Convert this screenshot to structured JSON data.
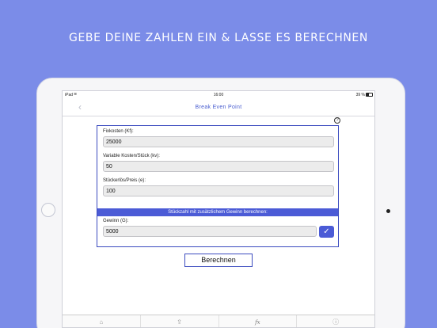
{
  "headline": "GEBE DEINE ZAHLEN EIN & LASSE ES BERECHNEN",
  "statusbar": {
    "carrier": "iPad",
    "time": "16:00",
    "battery": "39 %"
  },
  "navbar": {
    "back_icon": "‹",
    "title": "Break Even Point"
  },
  "help_icon": "?",
  "form": {
    "fixkosten": {
      "label": "Fixkosten (Kf):",
      "value": "25000"
    },
    "variable": {
      "label": "Variable Kosten/Stück (kv):",
      "value": "50"
    },
    "preis": {
      "label": "Stückerlös/Preis (e):",
      "value": "100"
    },
    "bar_text": "Stückzahl mit zusätzlichem Gewinn berechnen:",
    "gewinn": {
      "label": "Gewinn (G):",
      "value": "5000"
    },
    "check_icon": "✓"
  },
  "calc_button": "Berechnen",
  "tabbar": {
    "home_icon": "⌂",
    "share_icon": "⇪",
    "fx_label": "fx",
    "info_icon": "ⓘ"
  },
  "colors": {
    "background": "#7b8ce8",
    "accent": "#4b5bd6"
  }
}
